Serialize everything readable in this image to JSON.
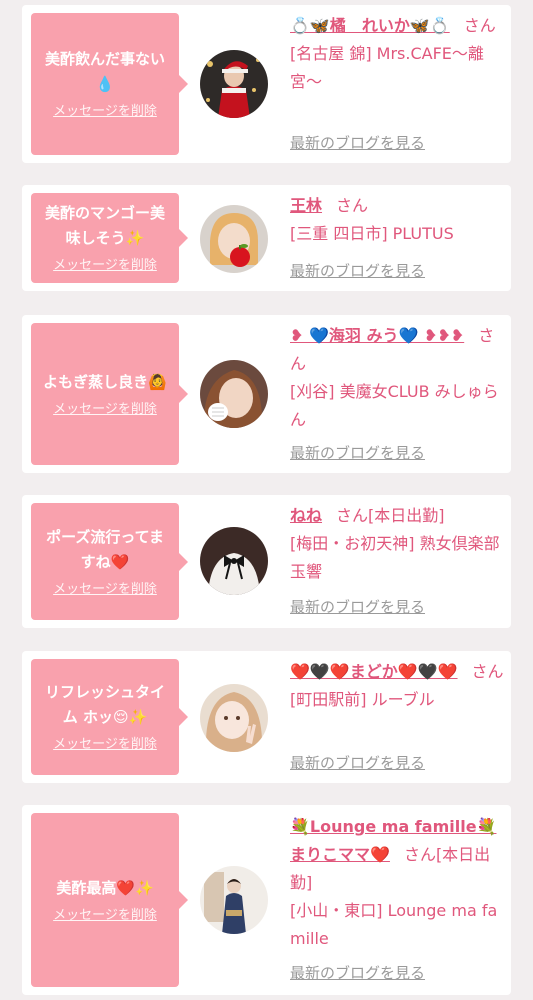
{
  "theme": {
    "accent": "#e0577c",
    "bubble": "#f9a1ad",
    "background": "#f2eeef"
  },
  "cards": [
    {
      "message": "美酢飲んだ事ない💧",
      "delete_label": "メッセージを削除",
      "name": "💍🦋橘　れいか🦋💍",
      "san": "さん",
      "shop": "[名古屋 錦] Mrs.CAFE〜離宮〜",
      "blog_label": "最新のブログを見る",
      "avatar": "santa-costume-photo"
    },
    {
      "message": "美酢のマンゴー美味しそう✨",
      "delete_label": "メッセージを削除",
      "name": "王林",
      "san": "さん",
      "shop": "[三重 四日市] PLUTUS",
      "blog_label": "最新のブログを見る",
      "avatar": "apple-face-photo"
    },
    {
      "message": "よもぎ蒸し良き🙆",
      "delete_label": "メッセージを削除",
      "name": "❥ 💙海羽 みう💙 ❥❥❥",
      "san": "さん",
      "shop": "[刈谷] 美魔女CLUB みしゅらん",
      "blog_label": "最新のブログを見る",
      "avatar": "selfie-photo"
    },
    {
      "message": "ポーズ流行ってますね❤️",
      "delete_label": "メッセージを削除",
      "name": "ねね",
      "san": "さん[本日出勤]",
      "shop": "[梅田・お初天神] 熟女倶楽部 玉響",
      "blog_label": "最新のブログを見る",
      "avatar": "ribbon-blouse-photo"
    },
    {
      "message": "リフレッシュタイム ホッ😌✨",
      "delete_label": "メッセージを削除",
      "name": "❤️🖤❤️まどか❤️🖤❤️",
      "san": "さん",
      "shop": "[町田駅前] ルーブル",
      "blog_label": "最新のブログを見る",
      "avatar": "peace-sign-photo"
    },
    {
      "message": "美酢最高❤️✨",
      "delete_label": "メッセージを削除",
      "name": "💐Lounge ma famille💐まりこママ❤️",
      "san": "さん[本日出勤]",
      "shop": "[小山・東口] Lounge ma famille",
      "blog_label": "最新のブログを見る",
      "avatar": "kimono-photo"
    }
  ]
}
